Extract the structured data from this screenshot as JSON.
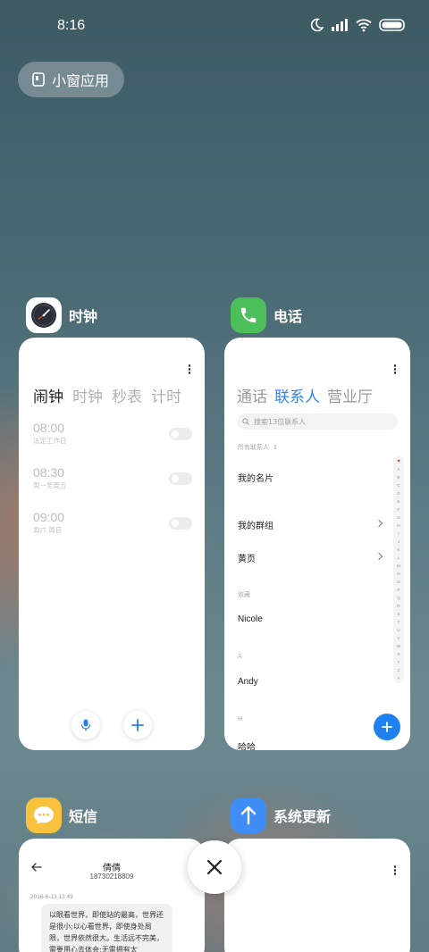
{
  "status_bar": {
    "time": "8:16",
    "icons": [
      "moon-icon",
      "signal-icon",
      "wifi-icon",
      "battery-icon"
    ]
  },
  "floating_window_button": {
    "label": "小窗应用",
    "icon": "small-window-icon"
  },
  "apps": {
    "clock": {
      "name": "时钟",
      "tabs": [
        "闹钟",
        "时钟",
        "秒表",
        "计时"
      ],
      "active_tab": "闹钟",
      "alarms": [
        {
          "time": "08:00",
          "subtitle": "法定工作日"
        },
        {
          "time": "08:30",
          "subtitle": "周一至周五"
        },
        {
          "time": "09:00",
          "subtitle": "周六 周日"
        }
      ]
    },
    "phone": {
      "name": "电话",
      "tabs": [
        "通话",
        "联系人",
        "营业厅"
      ],
      "active_tab": "联系人",
      "search_placeholder": "搜索13位联系人",
      "filter_label": "所有联系人",
      "items": {
        "my_card": "我的名片",
        "my_groups": "我的群组",
        "yellow_pages": "黄页"
      },
      "sections": {
        "favorites": "收藏",
        "a": "A",
        "h": "H"
      },
      "contacts": {
        "nicole": "Nicole",
        "andy": "Andy",
        "haha": "哈哈"
      },
      "index_letters": [
        "A",
        "B",
        "C",
        "D",
        "E",
        "F",
        "G",
        "H",
        "I",
        "J",
        "K",
        "L",
        "M",
        "N",
        "O",
        "P",
        "Q",
        "R",
        "S",
        "T",
        "U",
        "V",
        "W",
        "X",
        "Y",
        "Z",
        "#"
      ]
    },
    "messages": {
      "name": "短信",
      "contact_name": "倩倩",
      "contact_number": "18730218809",
      "message_time": "2016-6-13 13:49",
      "message_text": "以眼看世界，即使站的最高，世界还是很小;以心看世界，即使身处局限，世界依然很大。生活远不完美，需要用心去体会;无需拥有太"
    },
    "system_update": {
      "name": "系统更新"
    }
  },
  "colors": {
    "accent_blue": "#3482ff",
    "fab_blue": "#1f80f0",
    "phone_green": "#4cbf5a",
    "sms_yellow": "#f8c23c",
    "update_blue": "#3f8ef7"
  }
}
